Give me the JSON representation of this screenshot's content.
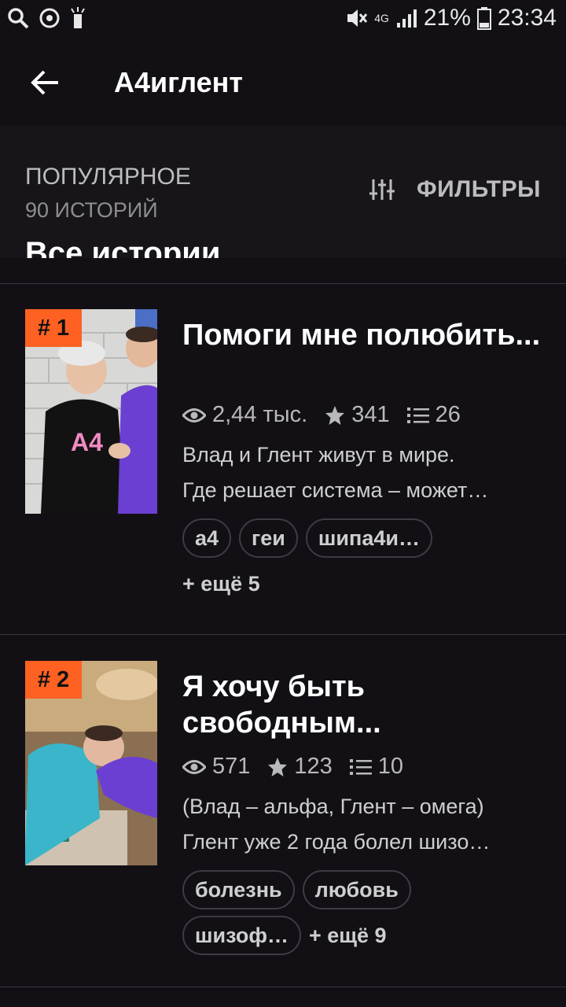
{
  "status_bar": {
    "signal_label": "4G",
    "battery": "21%",
    "time": "23:34"
  },
  "app_bar": {
    "title": "А4иглент"
  },
  "section": {
    "title": "ПОПУЛЯРНОЕ",
    "count": "90 ИСТОРИЙ",
    "filters_label": "ФИЛЬТРЫ",
    "peek_text": "Все истории"
  },
  "stories": [
    {
      "rank": "# 1",
      "title": "Помоги мне полюбить...",
      "views": "2,44 тыс.",
      "stars": "341",
      "chapters": "26",
      "desc_line1": "Влад и Глент живут в мире.",
      "desc_line2": "Где решает система – может…",
      "tags": [
        "а4",
        "геи",
        "шипа4и…"
      ],
      "more": "+ ещё 5"
    },
    {
      "rank": "# 2",
      "title": "Я хочу быть свободным...",
      "views": "571",
      "stars": "123",
      "chapters": "10",
      "desc_line1": "(Влад – альфа, Глент – омега)",
      "desc_line2": "Глент уже 2 года болел шизо…",
      "tags": [
        "болезнь",
        "любовь",
        "шизоф…"
      ],
      "more": "+ ещё 9"
    }
  ],
  "colors": {
    "background": "#121015",
    "rank_badge": "#ff6122",
    "text_secondary": "#b9b9b9"
  }
}
